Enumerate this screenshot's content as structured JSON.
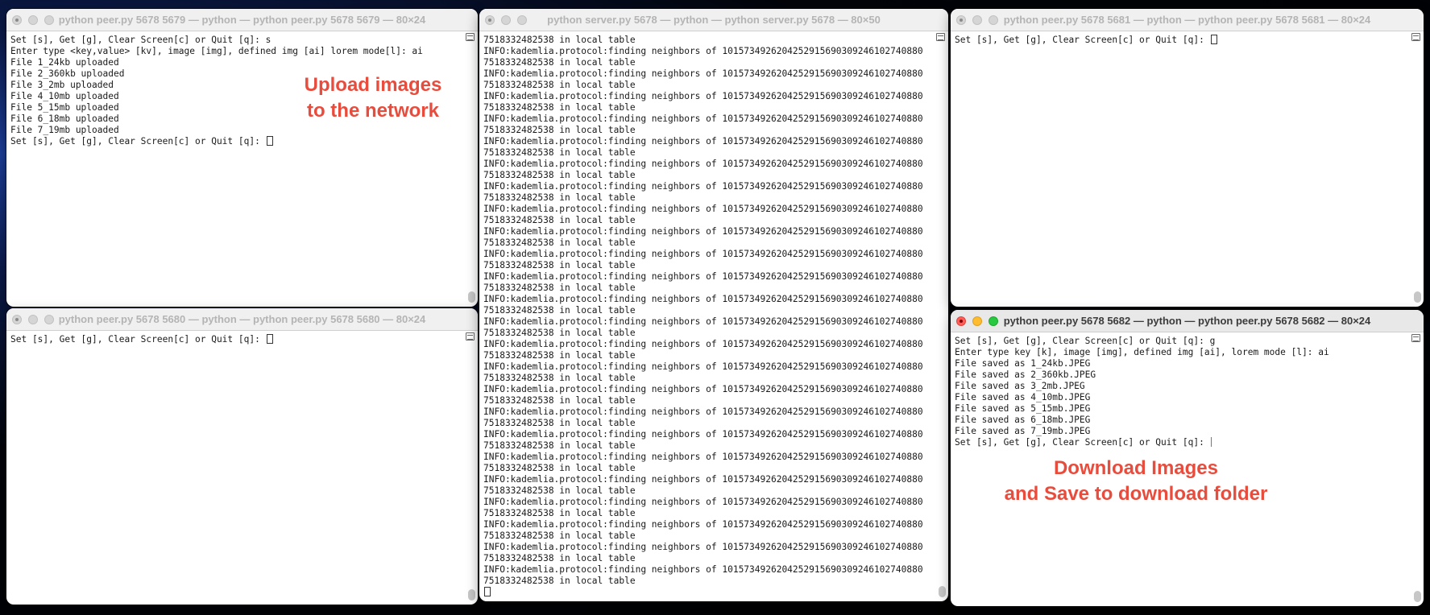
{
  "colors": {
    "annotation": "#e84c3d",
    "terminal_text": "#1a1a1a",
    "title_inactive": "#b4b4b4",
    "title_active": "#3b3b3b"
  },
  "windows": {
    "peer_5679": {
      "title": "python peer.py 5678 5679 — python — python peer.py 5678 5679 — 80×24",
      "lines": [
        "Set [s], Get [g], Clear Screen[c] or Quit [q]: s",
        "Enter type <key,value> [kv], image [img], defined img [ai] lorem mode[l]: ai",
        "File 1_24kb uploaded",
        "File 2_360kb uploaded",
        "File 3_2mb uploaded",
        "File 4_10mb uploaded",
        "File 5_15mb uploaded",
        "File 6_18mb uploaded",
        "File 7_19mb uploaded"
      ],
      "prompt": "Set [s], Get [g], Clear Screen[c] or Quit [q]: ",
      "annotation": [
        "Upload images",
        "to the network"
      ]
    },
    "peer_5680": {
      "title": "python peer.py 5678 5680 — python — python peer.py 5678 5680 — 80×24",
      "lines": [],
      "prompt": "Set [s], Get [g], Clear Screen[c] or Quit [q]: "
    },
    "server": {
      "title": "python server.py 5678 — python — python server.py 5678 — 80×50",
      "first_line": "7518332482538 in local table",
      "repeat_lines": [
        "INFO:kademlia.protocol:finding neighbors of 1015734926204252915690309246102740880",
        "7518332482538 in local table"
      ],
      "repeat_count": 24
    },
    "peer_5681": {
      "title": "python peer.py 5678 5681 — python — python peer.py 5678 5681 — 80×24",
      "lines": [],
      "prompt": "Set [s], Get [g], Clear Screen[c] or Quit [q]: "
    },
    "peer_5682": {
      "title": "python peer.py 5678 5682 — python — python peer.py 5678 5682 — 80×24",
      "lines": [
        "Set [s], Get [g], Clear Screen[c] or Quit [q]: g",
        "Enter type key [k], image [img], defined img [ai], lorem mode [l]: ai",
        "File saved as 1_24kb.JPEG",
        "File saved as 2_360kb.JPEG",
        "File saved as 3_2mb.JPEG",
        "File saved as 4_10mb.JPEG",
        "File saved as 5_15mb.JPEG",
        "File saved as 6_18mb.JPEG",
        "File saved as 7_19mb.JPEG"
      ],
      "prompt": "Set [s], Get [g], Clear Screen[c] or Quit [q]: ",
      "annotation": [
        "Download Images",
        "and Save to download folder"
      ]
    }
  }
}
